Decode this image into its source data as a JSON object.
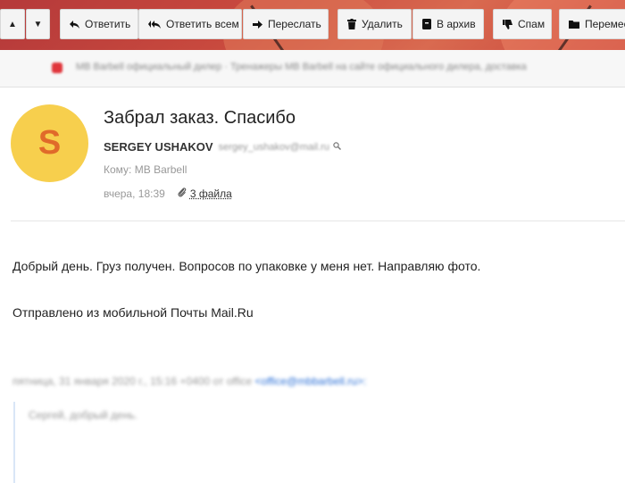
{
  "toolbar": {
    "up_arrow": "▲",
    "down_arrow": "▼",
    "reply": "Ответить",
    "reply_all": "Ответить всем",
    "forward": "Переслать",
    "delete": "Удалить",
    "archive": "В архив",
    "spam": "Спам",
    "move": "Перемест"
  },
  "notice": {
    "text": "MB Barbell официальный дилер · Тренажеры MB Barbell на сайте официального дилера, доставка"
  },
  "message": {
    "avatar_letter": "S",
    "subject": "Забрал заказ. Спасибо",
    "sender_name": "SERGEY USHAKOV",
    "sender_email": "sergey_ushakov@mail.ru",
    "to_label": "Кому:",
    "to_value": "MB Barbell",
    "date": "вчера, 18:39",
    "attachments": "3 файла",
    "body_line1": "Добрый день. Груз получен. Вопросов по упаковке у меня нет. Направляю фото.",
    "body_line2": "Отправлено из мобильной Почты Mail.Ru",
    "quote_header": "пятница, 31 января 2020 г., 15:16 +0400 от office ",
    "quote_link": "<office@mbbarbell.ru>:",
    "quote_text": "Сергей, добрый день."
  },
  "colors": {
    "toolbar_accent": "#c94a3e",
    "avatar_bg": "#f7cf4d",
    "avatar_letter": "#e06a2a",
    "link": "#2a6fd6"
  }
}
